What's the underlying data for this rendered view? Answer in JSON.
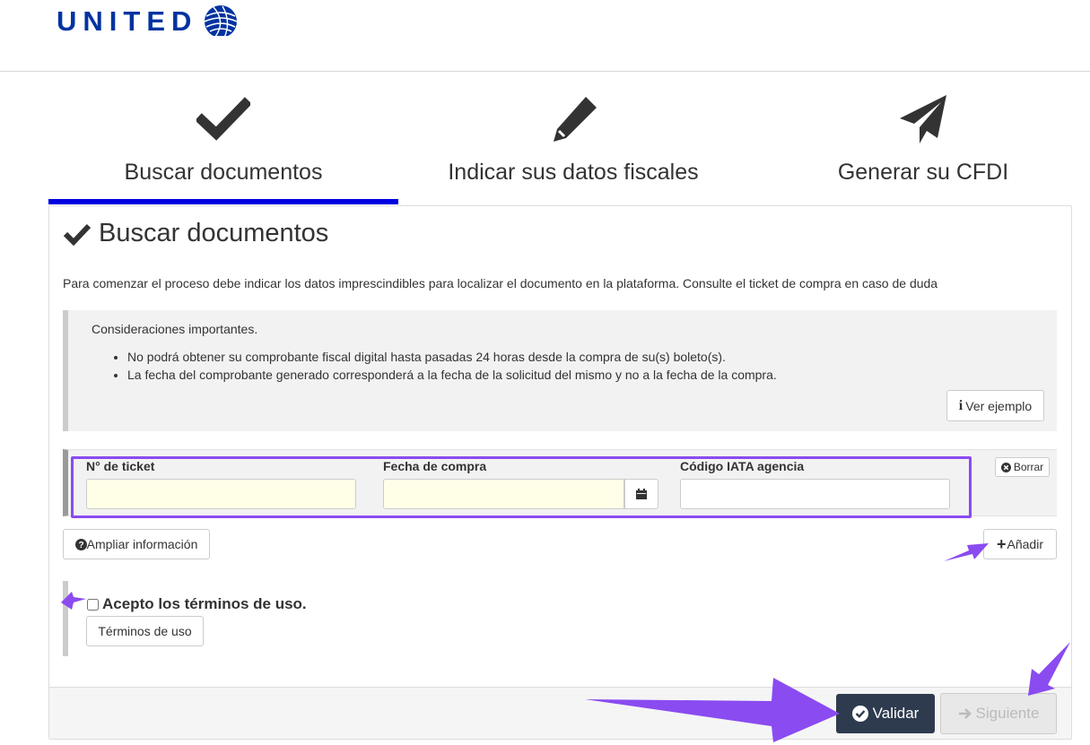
{
  "brand": {
    "logo_text": "UNITED",
    "color": "#0033a0"
  },
  "steps": [
    {
      "label": "Buscar documentos",
      "icon": "check-icon",
      "active": true
    },
    {
      "label": "Indicar sus datos fiscales",
      "icon": "pencil-icon",
      "active": false
    },
    {
      "label": "Generar su CFDI",
      "icon": "paper-plane-icon",
      "active": false
    }
  ],
  "panel": {
    "title": "Buscar documentos",
    "intro": "Para comenzar el proceso debe indicar los datos imprescindibles para localizar el documento en la plataforma. Consulte el ticket de compra en caso de duda"
  },
  "notice": {
    "title": "Consideraciones importantes.",
    "items": [
      "No podrá obtener su comprobante fiscal digital hasta pasadas 24 horas desde la compra de su(s) boleto(s).",
      "La fecha del comprobante generado corresponderá a la fecha de la solicitud del mismo y no a la fecha de la compra."
    ],
    "example_button": "Ver ejemplo"
  },
  "ticket_form": {
    "ticket_label": "N° de ticket",
    "ticket_value": "",
    "date_label": "Fecha de compra",
    "date_value": "",
    "iata_label": "Código IATA agencia",
    "iata_value": "",
    "clear_button": "Borrar"
  },
  "actions": {
    "more_info": "Ampliar información",
    "add": "Añadir"
  },
  "terms": {
    "accept_label": "Acepto los términos de uso.",
    "terms_button": "Términos de uso"
  },
  "footer": {
    "validate": "Validar",
    "next": "Siguiente"
  },
  "colors": {
    "active_step": "#0000e0",
    "annotation": "#8a4bf0",
    "validate_bg": "#2e3b4e"
  }
}
